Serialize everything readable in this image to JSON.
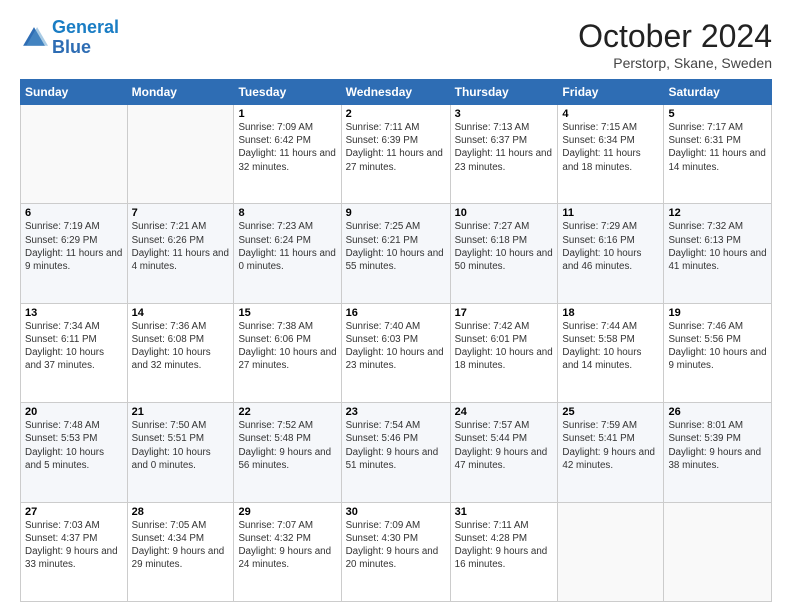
{
  "logo": {
    "line1": "General",
    "line2": "Blue"
  },
  "title": "October 2024",
  "subtitle": "Perstorp, Skane, Sweden",
  "days_of_week": [
    "Sunday",
    "Monday",
    "Tuesday",
    "Wednesday",
    "Thursday",
    "Friday",
    "Saturday"
  ],
  "weeks": [
    [
      {
        "day": "",
        "sunrise": "",
        "sunset": "",
        "daylight": ""
      },
      {
        "day": "",
        "sunrise": "",
        "sunset": "",
        "daylight": ""
      },
      {
        "day": "1",
        "sunrise": "Sunrise: 7:09 AM",
        "sunset": "Sunset: 6:42 PM",
        "daylight": "Daylight: 11 hours and 32 minutes."
      },
      {
        "day": "2",
        "sunrise": "Sunrise: 7:11 AM",
        "sunset": "Sunset: 6:39 PM",
        "daylight": "Daylight: 11 hours and 27 minutes."
      },
      {
        "day": "3",
        "sunrise": "Sunrise: 7:13 AM",
        "sunset": "Sunset: 6:37 PM",
        "daylight": "Daylight: 11 hours and 23 minutes."
      },
      {
        "day": "4",
        "sunrise": "Sunrise: 7:15 AM",
        "sunset": "Sunset: 6:34 PM",
        "daylight": "Daylight: 11 hours and 18 minutes."
      },
      {
        "day": "5",
        "sunrise": "Sunrise: 7:17 AM",
        "sunset": "Sunset: 6:31 PM",
        "daylight": "Daylight: 11 hours and 14 minutes."
      }
    ],
    [
      {
        "day": "6",
        "sunrise": "Sunrise: 7:19 AM",
        "sunset": "Sunset: 6:29 PM",
        "daylight": "Daylight: 11 hours and 9 minutes."
      },
      {
        "day": "7",
        "sunrise": "Sunrise: 7:21 AM",
        "sunset": "Sunset: 6:26 PM",
        "daylight": "Daylight: 11 hours and 4 minutes."
      },
      {
        "day": "8",
        "sunrise": "Sunrise: 7:23 AM",
        "sunset": "Sunset: 6:24 PM",
        "daylight": "Daylight: 11 hours and 0 minutes."
      },
      {
        "day": "9",
        "sunrise": "Sunrise: 7:25 AM",
        "sunset": "Sunset: 6:21 PM",
        "daylight": "Daylight: 10 hours and 55 minutes."
      },
      {
        "day": "10",
        "sunrise": "Sunrise: 7:27 AM",
        "sunset": "Sunset: 6:18 PM",
        "daylight": "Daylight: 10 hours and 50 minutes."
      },
      {
        "day": "11",
        "sunrise": "Sunrise: 7:29 AM",
        "sunset": "Sunset: 6:16 PM",
        "daylight": "Daylight: 10 hours and 46 minutes."
      },
      {
        "day": "12",
        "sunrise": "Sunrise: 7:32 AM",
        "sunset": "Sunset: 6:13 PM",
        "daylight": "Daylight: 10 hours and 41 minutes."
      }
    ],
    [
      {
        "day": "13",
        "sunrise": "Sunrise: 7:34 AM",
        "sunset": "Sunset: 6:11 PM",
        "daylight": "Daylight: 10 hours and 37 minutes."
      },
      {
        "day": "14",
        "sunrise": "Sunrise: 7:36 AM",
        "sunset": "Sunset: 6:08 PM",
        "daylight": "Daylight: 10 hours and 32 minutes."
      },
      {
        "day": "15",
        "sunrise": "Sunrise: 7:38 AM",
        "sunset": "Sunset: 6:06 PM",
        "daylight": "Daylight: 10 hours and 27 minutes."
      },
      {
        "day": "16",
        "sunrise": "Sunrise: 7:40 AM",
        "sunset": "Sunset: 6:03 PM",
        "daylight": "Daylight: 10 hours and 23 minutes."
      },
      {
        "day": "17",
        "sunrise": "Sunrise: 7:42 AM",
        "sunset": "Sunset: 6:01 PM",
        "daylight": "Daylight: 10 hours and 18 minutes."
      },
      {
        "day": "18",
        "sunrise": "Sunrise: 7:44 AM",
        "sunset": "Sunset: 5:58 PM",
        "daylight": "Daylight: 10 hours and 14 minutes."
      },
      {
        "day": "19",
        "sunrise": "Sunrise: 7:46 AM",
        "sunset": "Sunset: 5:56 PM",
        "daylight": "Daylight: 10 hours and 9 minutes."
      }
    ],
    [
      {
        "day": "20",
        "sunrise": "Sunrise: 7:48 AM",
        "sunset": "Sunset: 5:53 PM",
        "daylight": "Daylight: 10 hours and 5 minutes."
      },
      {
        "day": "21",
        "sunrise": "Sunrise: 7:50 AM",
        "sunset": "Sunset: 5:51 PM",
        "daylight": "Daylight: 10 hours and 0 minutes."
      },
      {
        "day": "22",
        "sunrise": "Sunrise: 7:52 AM",
        "sunset": "Sunset: 5:48 PM",
        "daylight": "Daylight: 9 hours and 56 minutes."
      },
      {
        "day": "23",
        "sunrise": "Sunrise: 7:54 AM",
        "sunset": "Sunset: 5:46 PM",
        "daylight": "Daylight: 9 hours and 51 minutes."
      },
      {
        "day": "24",
        "sunrise": "Sunrise: 7:57 AM",
        "sunset": "Sunset: 5:44 PM",
        "daylight": "Daylight: 9 hours and 47 minutes."
      },
      {
        "day": "25",
        "sunrise": "Sunrise: 7:59 AM",
        "sunset": "Sunset: 5:41 PM",
        "daylight": "Daylight: 9 hours and 42 minutes."
      },
      {
        "day": "26",
        "sunrise": "Sunrise: 8:01 AM",
        "sunset": "Sunset: 5:39 PM",
        "daylight": "Daylight: 9 hours and 38 minutes."
      }
    ],
    [
      {
        "day": "27",
        "sunrise": "Sunrise: 7:03 AM",
        "sunset": "Sunset: 4:37 PM",
        "daylight": "Daylight: 9 hours and 33 minutes."
      },
      {
        "day": "28",
        "sunrise": "Sunrise: 7:05 AM",
        "sunset": "Sunset: 4:34 PM",
        "daylight": "Daylight: 9 hours and 29 minutes."
      },
      {
        "day": "29",
        "sunrise": "Sunrise: 7:07 AM",
        "sunset": "Sunset: 4:32 PM",
        "daylight": "Daylight: 9 hours and 24 minutes."
      },
      {
        "day": "30",
        "sunrise": "Sunrise: 7:09 AM",
        "sunset": "Sunset: 4:30 PM",
        "daylight": "Daylight: 9 hours and 20 minutes."
      },
      {
        "day": "31",
        "sunrise": "Sunrise: 7:11 AM",
        "sunset": "Sunset: 4:28 PM",
        "daylight": "Daylight: 9 hours and 16 minutes."
      },
      {
        "day": "",
        "sunrise": "",
        "sunset": "",
        "daylight": ""
      },
      {
        "day": "",
        "sunrise": "",
        "sunset": "",
        "daylight": ""
      }
    ]
  ]
}
